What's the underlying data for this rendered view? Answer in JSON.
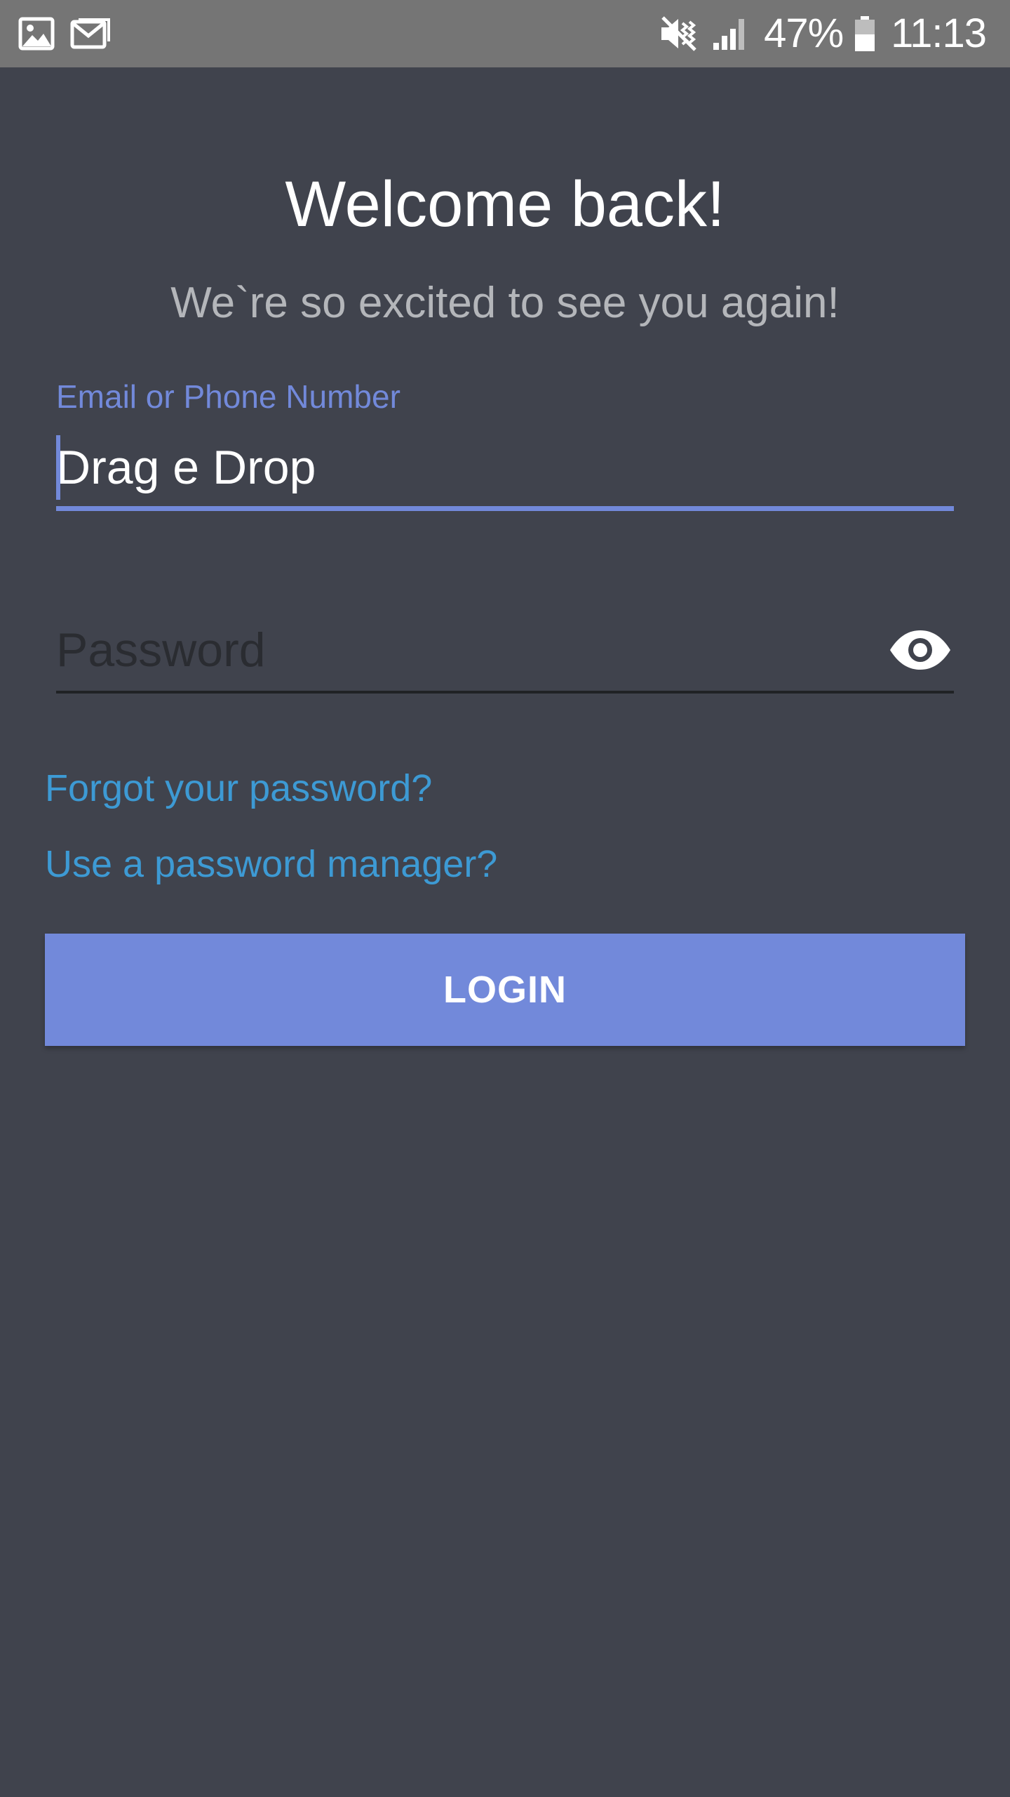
{
  "status_bar": {
    "left_icons": [
      "image-icon",
      "mail-icon"
    ],
    "right_icons": [
      "vibrate-mute-icon",
      "signal-icon",
      "battery-icon"
    ],
    "battery": "47%",
    "time": "11:13"
  },
  "login": {
    "title": "Welcome back!",
    "subtitle": "We`re so excited to see you again!",
    "email_label": "Email or Phone Number",
    "email_value": "Drag e Drop",
    "password_placeholder": "Password",
    "password_value": "",
    "forgot_link": "Forgot your password?",
    "manager_link": "Use a password manager?",
    "login_button": "LOGIN"
  },
  "colors": {
    "background": "#40434d",
    "status_bar": "#757575",
    "accent": "#7289da",
    "link": "#3d9ad4",
    "subtitle": "#b4b6ba"
  }
}
